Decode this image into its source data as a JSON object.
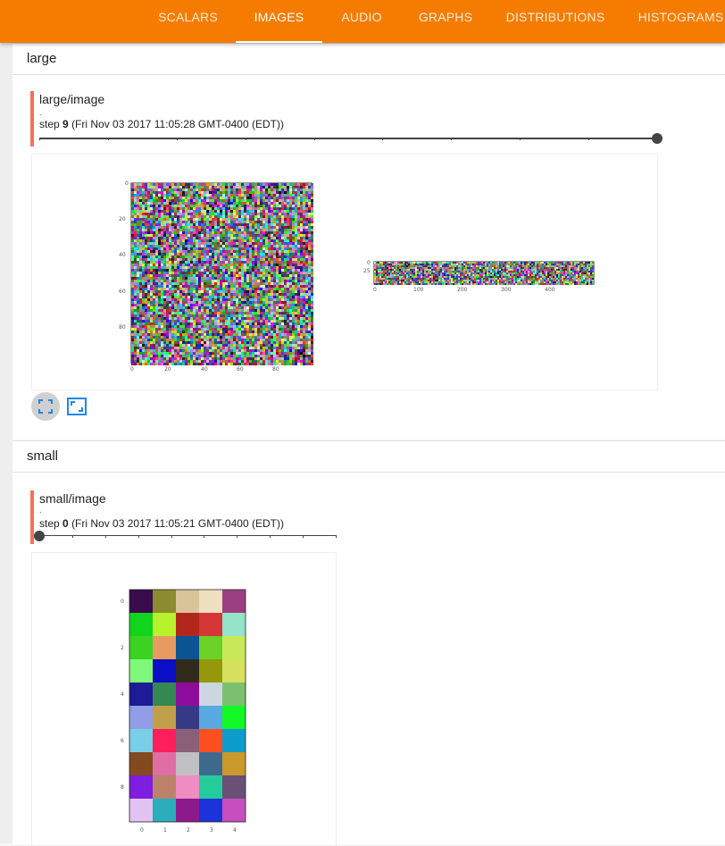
{
  "tabs": [
    {
      "label": "SCALARS",
      "active": false
    },
    {
      "label": "IMAGES",
      "active": true
    },
    {
      "label": "AUDIO",
      "active": false
    },
    {
      "label": "GRAPHS",
      "active": false
    },
    {
      "label": "DISTRIBUTIONS",
      "active": false
    },
    {
      "label": "HISTOGRAMS",
      "active": false
    }
  ],
  "accent_color": "#f57c00",
  "groups": [
    {
      "name": "large",
      "card": {
        "title": "large/image",
        "dot": ".",
        "step_prefix": "step",
        "step": "9",
        "timestamp": "(Fri Nov 03 2017 11:05:28 GMT-0400 (EDT))",
        "slider_position": 1.0,
        "images": [
          {
            "y_ticks": [
              "0",
              "20",
              "40",
              "60",
              "80"
            ],
            "x_ticks": [
              "0",
              "20",
              "40",
              "60",
              "80"
            ]
          },
          {
            "y_ticks": [
              "0",
              "25"
            ],
            "x_ticks": [
              "0",
              "100",
              "200",
              "300",
              "400"
            ]
          }
        ],
        "controls": [
          "fullscreen-icon",
          "fit-to-window-icon"
        ]
      }
    },
    {
      "name": "small",
      "card": {
        "title": "small/image",
        "dot": ".",
        "step_prefix": "step",
        "step": "0",
        "timestamp": "(Fri Nov 03 2017 11:05:21 GMT-0400 (EDT))",
        "slider_position": 0.0,
        "y_ticks": [
          "0",
          "2",
          "4",
          "6",
          "8"
        ],
        "x_ticks": [
          "0",
          "1",
          "2",
          "3",
          "4"
        ],
        "grid_colors": [
          [
            "#3a0b4d",
            "#8b8c2f",
            "#d9c49a",
            "#f0dfc0",
            "#9b3f80"
          ],
          [
            "#13d41c",
            "#b8f22c",
            "#b1281b",
            "#d63636",
            "#95e3c8"
          ],
          [
            "#3cd221",
            "#e89a60",
            "#0b5493",
            "#6ad126",
            "#c8ea5a"
          ],
          [
            "#80f97a",
            "#0a0ec4",
            "#322a1d",
            "#95980b",
            "#d6e15f"
          ],
          [
            "#1d1b95",
            "#358852",
            "#8d0c99",
            "#ccd6e0",
            "#7cc070"
          ],
          [
            "#8f9ee6",
            "#c09f4a",
            "#363a86",
            "#5aaae1",
            "#12f824"
          ],
          [
            "#78cfe7",
            "#fd1f5b",
            "#8b5f77",
            "#fd5021",
            "#0d9dcc"
          ],
          [
            "#834a20",
            "#e06da4",
            "#c0c0c2",
            "#3f6a8f",
            "#c9992b"
          ],
          [
            "#7f1de0",
            "#bd826a",
            "#ef8cc2",
            "#24cb9b",
            "#6a4f77"
          ],
          [
            "#e0c2f3",
            "#2aaebb",
            "#8d1a8c",
            "#1b33d8",
            "#c64ebf"
          ]
        ]
      }
    }
  ]
}
